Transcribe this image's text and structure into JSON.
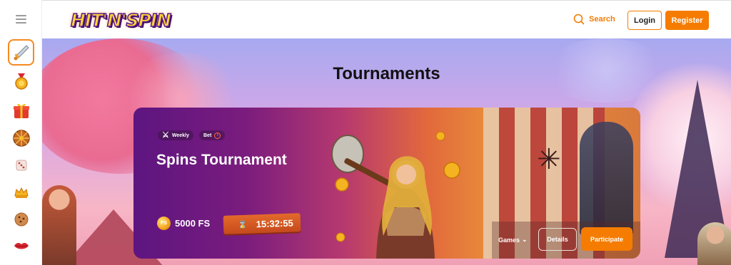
{
  "header": {
    "logo_text": "HIT'N'SPIN",
    "search_label": "Search",
    "login_label": "Login",
    "register_label": "Register"
  },
  "rail": {
    "items": [
      {
        "icon": "sword-icon",
        "active": true
      },
      {
        "icon": "medal-icon"
      },
      {
        "icon": "gift-icon"
      },
      {
        "icon": "wheel-icon"
      },
      {
        "icon": "dice-icon"
      },
      {
        "icon": "crown-icon"
      },
      {
        "icon": "cookie-icon"
      },
      {
        "icon": "lips-icon"
      }
    ]
  },
  "hero": {
    "title": "Tournaments"
  },
  "tournament": {
    "chip_weekly": "Weekly",
    "chip_bet": "Bet",
    "title": "Spins Tournament",
    "coin_label": "FS",
    "prize": "5000 FS",
    "timer": "15:32:55",
    "games_label": "Games",
    "details_label": "Details",
    "participate_label": "Participate"
  },
  "colors": {
    "accent": "#f57c00",
    "card_start": "#5d1580",
    "card_end": "#e88b3a"
  }
}
